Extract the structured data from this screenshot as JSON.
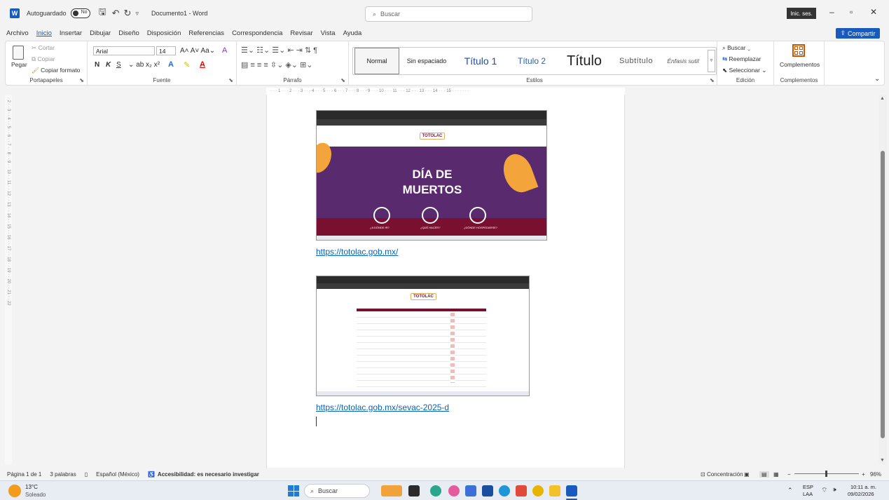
{
  "titlebar": {
    "autosave": "Autoguardado",
    "toggle": "No",
    "doc_title": "Documento1 - Word",
    "search": "Buscar",
    "signin": "Inic. ses."
  },
  "menu": [
    "Archivo",
    "Inicio",
    "Insertar",
    "Dibujar",
    "Diseño",
    "Disposición",
    "Referencias",
    "Correspondencia",
    "Revisar",
    "Vista",
    "Ayuda"
  ],
  "share": "Compartir",
  "ribbon": {
    "clipboard": {
      "paste": "Pegar",
      "cut": "Cortar",
      "copy": "Copiar",
      "format": "Copiar formato",
      "label": "Portapapeles"
    },
    "font": {
      "name": "Arial",
      "size": "14",
      "label": "Fuente",
      "bold": "N",
      "italic": "K",
      "underline": "S"
    },
    "paragraph": {
      "label": "Párrafo"
    },
    "styles": {
      "label": "Estilos",
      "items": [
        "Normal",
        "Sin espaciado",
        "Título 1",
        "Título 2",
        "Título",
        "Subtítulo",
        "Énfasis sutil"
      ]
    },
    "editing": {
      "find": "Buscar",
      "replace": "Reemplazar",
      "select": "Seleccionar",
      "label": "Edición"
    },
    "addins": {
      "button": "Complementos",
      "label": "Complementos"
    }
  },
  "document": {
    "link1": "https://totolac.gob.mx/",
    "link2": "https://totolac.gob.mx/sevac-2025-d",
    "shot1": {
      "logo": "TOTOLAC",
      "headline1": "DÍA DE",
      "headline2": "MUERTOS",
      "c1": "¿A DÓNDE IR?",
      "c2": "¿QUÉ HACER?",
      "c3": "¿DÓNDE HOSPEDARSE?"
    },
    "shot2": {
      "logo": "TOTOLAC"
    }
  },
  "status": {
    "page": "Página 1 de 1",
    "words": "3 palabras",
    "lang": "Español (México)",
    "access": "Accesibilidad: es necesario investigar",
    "focus": "Concentración",
    "zoom": "96%"
  },
  "taskbar": {
    "temp": "13°C",
    "weather": "Soleado",
    "search": "Buscar",
    "lang1": "ESP",
    "lang2": "LAA",
    "time": "10:11 a. m.",
    "date": "09/02/2026"
  },
  "colors": {
    "accent": "#185abd",
    "maroon": "#7a1030",
    "purple": "#5a2a6e",
    "gold": "#f3a43a"
  }
}
